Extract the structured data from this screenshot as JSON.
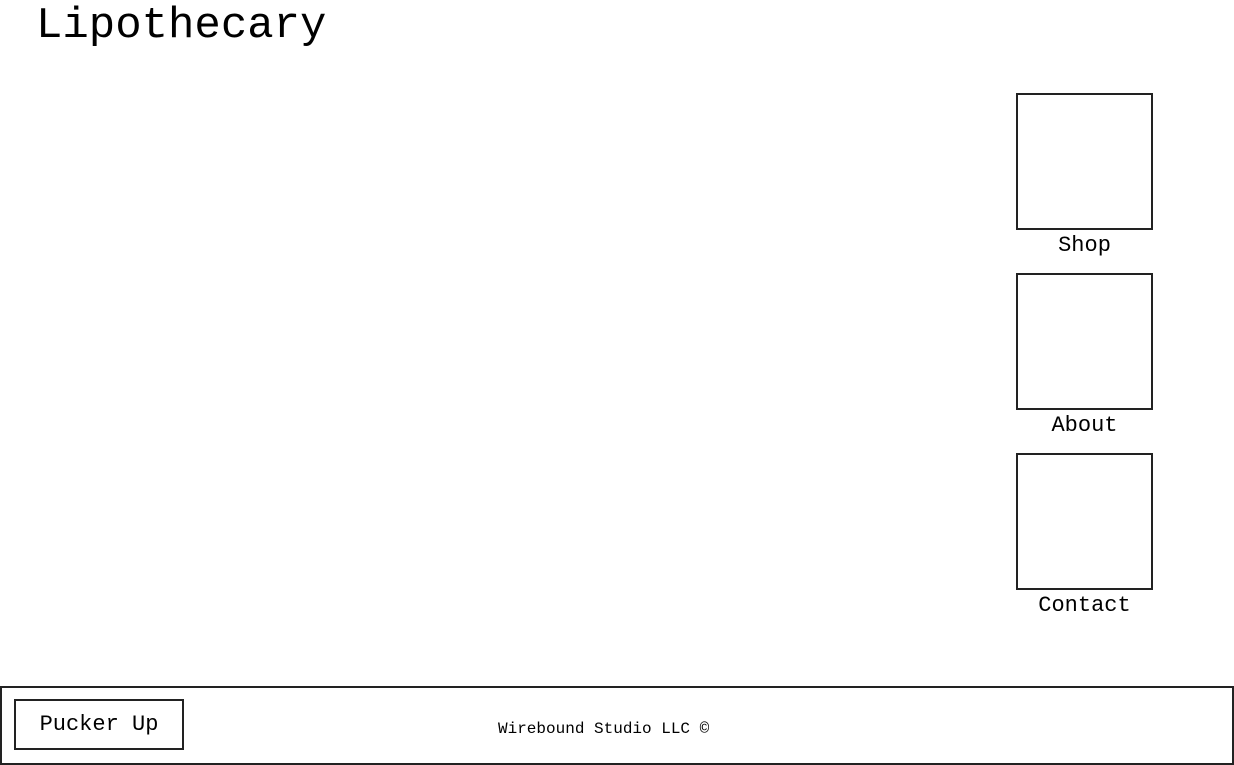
{
  "header": {
    "title": "Lipothecary"
  },
  "nav": {
    "items": [
      {
        "label": "Shop"
      },
      {
        "label": "About"
      },
      {
        "label": "Contact"
      }
    ]
  },
  "footer": {
    "button_label": "Pucker Up",
    "copyright": "Wirebound Studio LLC ©"
  },
  "colors": {
    "border": "#222222",
    "background": "#ffffff",
    "text": "#000000"
  }
}
